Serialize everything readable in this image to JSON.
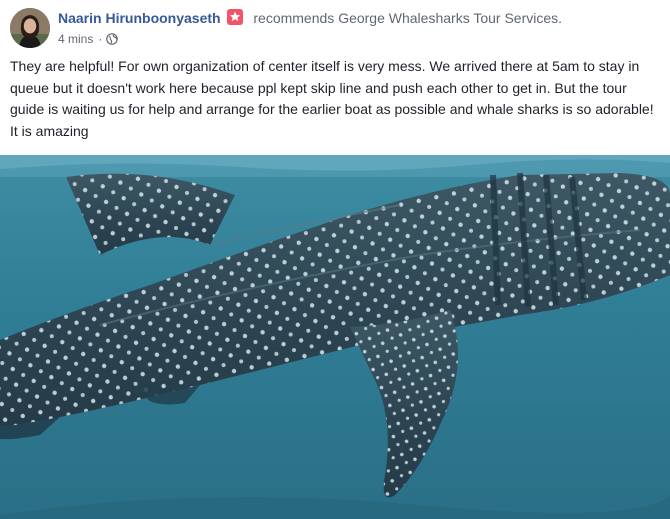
{
  "post": {
    "author": "Naarin Hirunboonyaseth",
    "action_text": "recommends",
    "page_name": "George Whalesharks Tour Services.",
    "timestamp": "4 mins",
    "separator": "·",
    "privacy_icon": "globe-icon",
    "recommend_icon": "recommendation-star-icon",
    "body": "They are helpful! For own organization of center itself is very mess. We arrived there at 5am to stay in queue but it doesn't work here because ppl kept skip line and push each other to get in. But the tour guide is waiting us for help and arrange for the earlier boat as possible and whale sharks is so adorable! It is amazing"
  },
  "colors": {
    "author_link": "#365899",
    "secondary_text": "#606770",
    "body_text": "#1d2129",
    "recommend_badge": "#f35369",
    "water": "#2f7d95"
  }
}
